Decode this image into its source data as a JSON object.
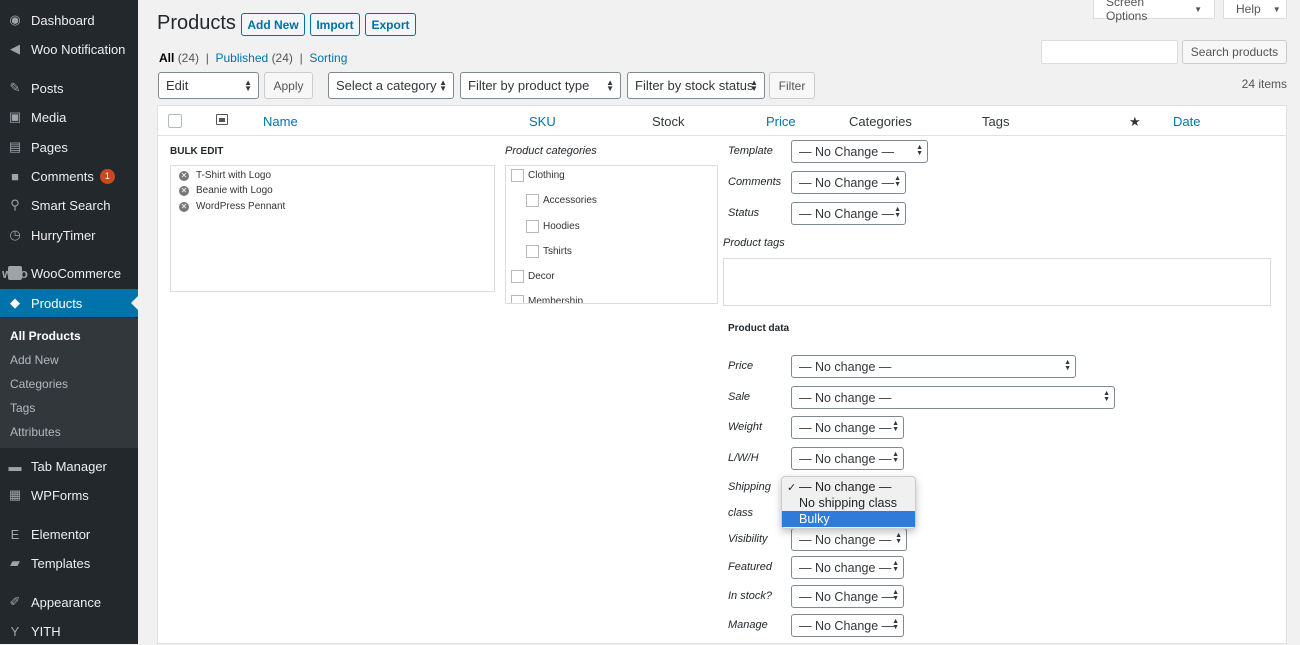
{
  "sidebar": {
    "items": [
      {
        "label": "Dashboard",
        "icon": "dashboard-icon",
        "glyph": "◉"
      },
      {
        "label": "Woo Notification",
        "icon": "megaphone-icon",
        "glyph": "◀"
      },
      {
        "label": "Posts",
        "icon": "pushpin-icon",
        "glyph": "✎"
      },
      {
        "label": "Media",
        "icon": "media-icon",
        "glyph": "▣"
      },
      {
        "label": "Pages",
        "icon": "pages-icon",
        "glyph": "▤"
      },
      {
        "label": "Comments",
        "icon": "comment-icon",
        "glyph": "■",
        "badge": "1"
      },
      {
        "label": "Smart Search",
        "icon": "search-icon",
        "glyph": "⚲"
      },
      {
        "label": "HurryTimer",
        "icon": "timer-icon",
        "glyph": "◷"
      },
      {
        "label": "WooCommerce",
        "icon": "woocommerce-icon",
        "glyph": "woo"
      },
      {
        "label": "Products",
        "icon": "products-box-icon",
        "glyph": "◆"
      },
      {
        "label": "Tab Manager",
        "icon": "tab-manager-icon",
        "glyph": "▬"
      },
      {
        "label": "WPForms",
        "icon": "wpforms-icon",
        "glyph": "▦"
      },
      {
        "label": "Elementor",
        "icon": "elementor-icon",
        "glyph": "E"
      },
      {
        "label": "Templates",
        "icon": "folder-icon",
        "glyph": "▰"
      },
      {
        "label": "Appearance",
        "icon": "paintbrush-icon",
        "glyph": "✐"
      },
      {
        "label": "YITH",
        "icon": "yith-icon",
        "glyph": "Y"
      }
    ],
    "submenu": [
      "All Products",
      "Add New",
      "Categories",
      "Tags",
      "Attributes"
    ]
  },
  "top": {
    "screen_options": "Screen Options",
    "help": "Help"
  },
  "header": {
    "title": "Products",
    "add_new": "Add New",
    "import": "Import",
    "export": "Export"
  },
  "views": {
    "all": "All",
    "all_count": "(24)",
    "sep": "|",
    "published": "Published",
    "published_count": "(24)",
    "sorting": "Sorting"
  },
  "tablenav": {
    "bulk_action": "Edit",
    "apply": "Apply",
    "category": "Select a category",
    "product_type": "Filter by product type",
    "stock_status": "Filter by stock status",
    "filter": "Filter",
    "items": "24 items"
  },
  "search": {
    "button": "Search products",
    "value": ""
  },
  "columns": {
    "name": "Name",
    "sku": "SKU",
    "stock": "Stock",
    "price": "Price",
    "categories": "Categories",
    "tags": "Tags",
    "featured": "★",
    "date": "Date"
  },
  "bulk_edit": {
    "title": "BULK EDIT",
    "items": [
      "T-Shirt with Logo",
      "Beanie with Logo",
      "WordPress Pennant"
    ],
    "categories_label": "Product categories",
    "categories": [
      {
        "name": "Clothing",
        "level": 0
      },
      {
        "name": "Accessories",
        "level": 1
      },
      {
        "name": "Hoodies",
        "level": 1
      },
      {
        "name": "Tshirts",
        "level": 1
      },
      {
        "name": "Decor",
        "level": 0
      },
      {
        "name": "Membership",
        "level": 0
      }
    ],
    "template_label": "Template",
    "template": "— No Change —",
    "comments_label": "Comments",
    "comments": "— No Change —",
    "status_label": "Status",
    "status": "— No Change —",
    "tags_label": "Product tags",
    "product_data": "Product data",
    "price_label": "Price",
    "price": "— No change —",
    "sale_label": "Sale",
    "sale": "— No change —",
    "weight_label": "Weight",
    "weight": "— No change —",
    "lwh_label": "L/W/H",
    "lwh": "— No change —",
    "shipping_label": "Shipping",
    "shipping_label2": "class",
    "visibility_label": "Visibility",
    "visibility": "— No change —",
    "featured_label": "Featured",
    "featured": "— No change —",
    "instock_label": "In stock?",
    "instock": "— No Change —",
    "manage_label": "Manage",
    "manage": "— No Change —"
  },
  "shipping_dropdown": {
    "options": [
      "— No change —",
      "No shipping class",
      "Bulky"
    ],
    "checked": "✓"
  }
}
